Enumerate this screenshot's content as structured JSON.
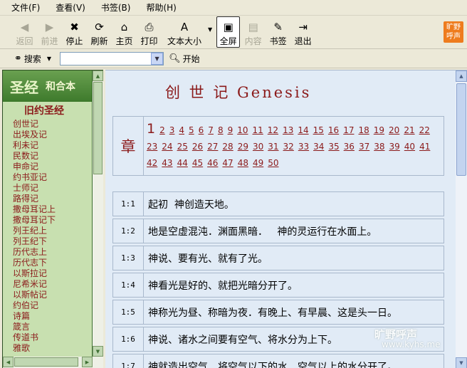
{
  "menu": [
    "文件(F)",
    "查看(V)",
    "书签(B)",
    "帮助(H)"
  ],
  "toolbar": {
    "buttons": [
      {
        "label": "返回",
        "icon": "back-arrow-icon",
        "glyph": "◀",
        "disabled": true
      },
      {
        "label": "前进",
        "icon": "forward-arrow-icon",
        "glyph": "▶",
        "disabled": true
      },
      {
        "label": "停止",
        "icon": "stop-icon",
        "glyph": "✖",
        "disabled": false
      },
      {
        "label": "刷新",
        "icon": "refresh-icon",
        "glyph": "⟳",
        "disabled": false
      },
      {
        "label": "主页",
        "icon": "home-icon",
        "glyph": "⌂",
        "disabled": false
      },
      {
        "label": "打印",
        "icon": "printer-icon",
        "glyph": "⎙",
        "disabled": false
      },
      {
        "label": "文本大小",
        "icon": "text-size-icon",
        "glyph": "A",
        "disabled": false
      },
      {
        "label": "全屏",
        "icon": "fullscreen-icon",
        "glyph": "▣",
        "disabled": false
      },
      {
        "label": "内容",
        "icon": "contents-icon",
        "glyph": "▤",
        "disabled": true
      },
      {
        "label": "书签",
        "icon": "bookmark-icon",
        "glyph": "✎",
        "disabled": false
      },
      {
        "label": "退出",
        "icon": "exit-icon",
        "glyph": "⇥",
        "disabled": false
      }
    ],
    "logo": "旷野呼声"
  },
  "address": {
    "search_label": "搜索",
    "input_value": "",
    "go_label": "开始"
  },
  "sidebar": {
    "title": "圣经",
    "subtitle": "和合本",
    "testament": "旧约圣经",
    "books": [
      "创世记",
      "出埃及记",
      "利未记",
      "民数记",
      "申命记",
      "约书亚记",
      "士师记",
      "路得记",
      "撒母耳记上",
      "撒母耳记下",
      "列王纪上",
      "列王纪下",
      "历代志上",
      "历代志下",
      "以斯拉记",
      "尼希米记",
      "以斯帖记",
      "约伯记",
      "诗篇",
      "箴言",
      "传道书",
      "雅歌"
    ]
  },
  "content": {
    "title": "创 世 记  Genesis",
    "chapter_label": "章",
    "chapters": [
      "1",
      "2",
      "3",
      "4",
      "5",
      "6",
      "7",
      "8",
      "9",
      "10",
      "11",
      "12",
      "13",
      "14",
      "15",
      "16",
      "17",
      "18",
      "19",
      "20",
      "21",
      "22",
      "23",
      "24",
      "25",
      "26",
      "27",
      "28",
      "29",
      "30",
      "31",
      "32",
      "33",
      "34",
      "35",
      "36",
      "37",
      "38",
      "39",
      "40",
      "41",
      "42",
      "43",
      "44",
      "45",
      "46",
      "47",
      "48",
      "49",
      "50"
    ],
    "current_chapter": "1",
    "verses": [
      {
        "ref": "1:1",
        "text": "起初  神创造天地。"
      },
      {
        "ref": "1:2",
        "text": "地是空虚混沌．渊面黑暗．   神的灵运行在水面上。"
      },
      {
        "ref": "1:3",
        "text": "神说、要有光、就有了光。"
      },
      {
        "ref": "1:4",
        "text": "神看光是好的、就把光暗分开了。"
      },
      {
        "ref": "1:5",
        "text": "神称光为昼、称暗为夜．有晚上、有早晨、这是头一日。"
      },
      {
        "ref": "1:6",
        "text": "神说、诸水之间要有空气、将水分为上下。"
      },
      {
        "ref": "1:7",
        "text": "神就造出空气、将空气以下的水、空气以上的水分开了。"
      }
    ],
    "watermark": "旷野呼声",
    "watermark_url": "www.kyhs.me"
  },
  "colors": {
    "accent": "#8b1a1a",
    "sidebar": "#3f6f33",
    "content_bg": "#e1ebf6",
    "logo": "#ee7c1e"
  }
}
